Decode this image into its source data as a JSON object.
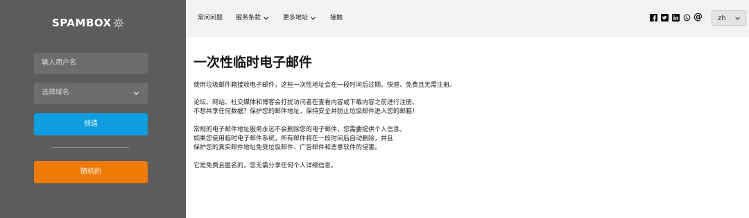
{
  "sidebar": {
    "logo_text": "SPAMBOX",
    "username_placeholder": "输入用户名",
    "domain_select": "选择域名",
    "create_label": "创造",
    "random_label": "随机的"
  },
  "nav": {
    "faq": "常问问题",
    "terms": "服务条款",
    "more": "更多地址",
    "contact": "接触"
  },
  "social_icons": [
    "facebook-icon",
    "twitter-icon",
    "linkedin-icon",
    "whatsapp-icon",
    "at-icon"
  ],
  "at_symbol": "@",
  "language": {
    "selected": "zh"
  },
  "main": {
    "title": "一次性临时电子邮件",
    "lines": [
      "使用垃圾邮件箱接收电子邮件，这些一次性地址会在一段时间后过期。快速、免费且无需注册。",
      "论坛、网站、社交媒体和博客会打扰访问者在查看内容或下载内容之前进行注册。",
      "不想共享任何数据？保护您的邮件地址，保持安全并防止垃圾邮件进入您的邮箱！",
      "常规的电子邮件地址服务永远不会删除您的电子邮件，您需要提供个人信息。",
      "如果您使用临时电子邮件系统，所有邮件将在一段时间后自动删除，并且",
      "保护您的真实邮件地址免受垃圾邮件、广告邮件和恶意软件的侵害。",
      "它是免费且匿名的，您无需分享任何个人详细信息。"
    ]
  },
  "colors": {
    "sidebar_bg": "#5c5c5c",
    "create_button": "#0e9ee0",
    "random_button": "#ef7a05",
    "topbar_bg": "#f2f2f2"
  }
}
